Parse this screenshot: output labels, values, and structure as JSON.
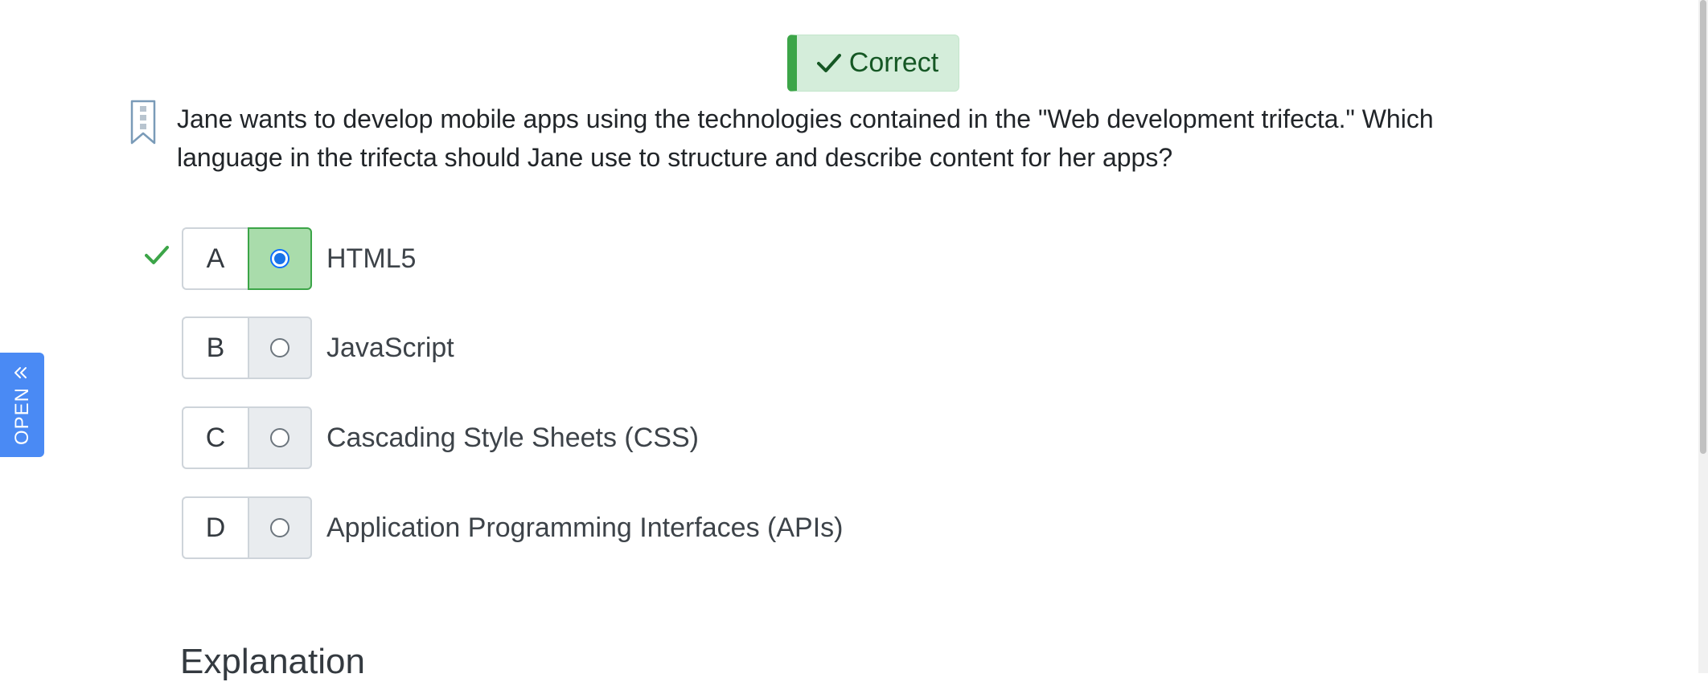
{
  "status": {
    "label": "Correct",
    "icon": "check-icon",
    "accent": "#3ca548",
    "background": "#d4edda",
    "text_color": "#155724"
  },
  "question": {
    "bookmark_icon": "bookmark-icon",
    "text": "Jane wants to develop mobile apps using the technologies contained in the \"Web development trifecta.\" Which language in the trifecta should Jane use to structure and describe content for her apps?"
  },
  "answers": [
    {
      "letter": "A",
      "text": "HTML5",
      "selected": true,
      "correct": true
    },
    {
      "letter": "B",
      "text": "JavaScript",
      "selected": false,
      "correct": false
    },
    {
      "letter": "C",
      "text": "Cascading Style Sheets (CSS)",
      "selected": false,
      "correct": false
    },
    {
      "letter": "D",
      "text": "Application Programming Interfaces (APIs)",
      "selected": false,
      "correct": false
    }
  ],
  "explanation": {
    "heading": "Explanation"
  },
  "side_tab": {
    "label": "OPEN",
    "icon": "double-chevron-right-icon",
    "color": "#4a8af4"
  }
}
